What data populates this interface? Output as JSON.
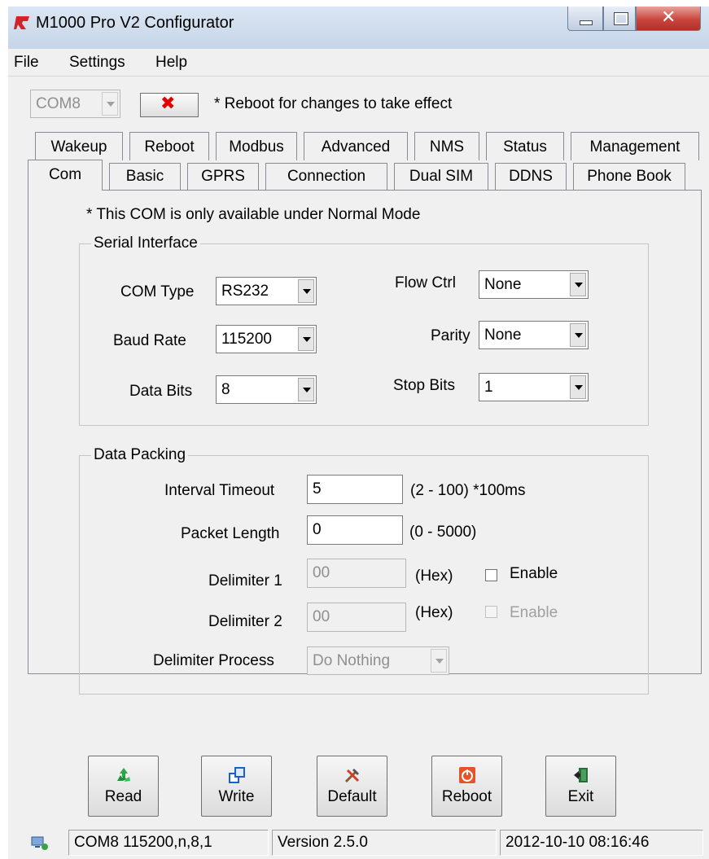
{
  "window": {
    "title": "M1000 Pro V2 Configurator"
  },
  "menu": {
    "items": [
      "File",
      "Settings",
      "Help"
    ]
  },
  "toolbar": {
    "port_value": "COM8",
    "reboot_note": "* Reboot for changes to take effect"
  },
  "tabs": {
    "row1": [
      "Wakeup",
      "Reboot",
      "Modbus",
      "Advanced",
      "NMS",
      "Status",
      "Management"
    ],
    "row2": [
      "Com",
      "Basic",
      "GPRS",
      "Connection",
      "Dual SIM",
      "DDNS",
      "Phone Book"
    ],
    "active": "Com"
  },
  "com": {
    "note": "* This COM is only available under Normal Mode",
    "serial": {
      "title": "Serial Interface",
      "com_type_label": "COM Type",
      "com_type": "RS232",
      "baud_label": "Baud Rate",
      "baud": "115200",
      "data_bits_label": "Data Bits",
      "data_bits": "8",
      "flow_label": "Flow Ctrl",
      "flow": "None",
      "parity_label": "Parity",
      "parity": "None",
      "stop_label": "Stop Bits",
      "stop": "1"
    },
    "packing": {
      "title": "Data Packing",
      "interval_label": "Interval Timeout",
      "interval": "5",
      "interval_hint": "(2 - 100) *100ms",
      "length_label": "Packet Length",
      "length": "0",
      "length_hint": "(0 - 5000)",
      "d1_label": "Delimiter 1",
      "d1": "00",
      "d1_hint": "(Hex)",
      "d1_enable": "Enable",
      "d2_label": "Delimiter 2",
      "d2": "00",
      "d2_hint": "(Hex)",
      "d2_enable": "Enable",
      "process_label": "Delimiter Process",
      "process": "Do Nothing"
    }
  },
  "buttons": {
    "read": "Read",
    "write": "Write",
    "default": "Default",
    "reboot": "Reboot",
    "exit": "Exit"
  },
  "status": {
    "port": "COM8 115200,n,8,1",
    "version": "Version 2.5.0",
    "datetime": "2012-10-10 08:16:46"
  },
  "colors": {
    "title_gradient": "#c5d5e8",
    "close_button": "#c9463d",
    "panel": "#f0f0f0"
  },
  "icons": [
    "app-logo-icon",
    "minimize-icon",
    "maximize-icon",
    "close-icon",
    "disconnect-x-icon",
    "recycle-icon",
    "write-icon",
    "tools-icon",
    "power-icon",
    "exit-door-icon",
    "network-icon"
  ]
}
